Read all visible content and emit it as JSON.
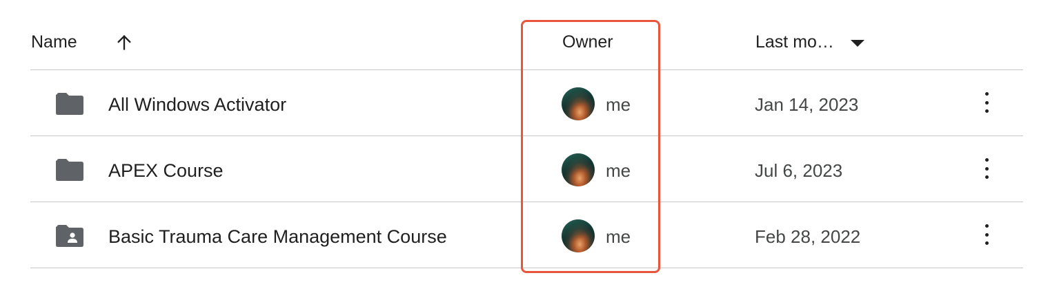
{
  "columns": {
    "name": "Name",
    "owner": "Owner",
    "last_modified": "Last mo…"
  },
  "icons": {
    "sort": "arrow-up-icon",
    "dropdown": "caret-down-icon",
    "folder": "folder-icon",
    "shared_folder": "shared-folder-icon",
    "more": "more-vert-icon"
  },
  "colors": {
    "highlight": "#e8553a",
    "folder": "#5f6368",
    "divider": "#c7c7c7"
  },
  "rows": [
    {
      "name": "All Windows Activator",
      "owner": "me",
      "modified": "Jan 14, 2023",
      "icon": "folder"
    },
    {
      "name": "APEX Course",
      "owner": "me",
      "modified": "Jul 6, 2023",
      "icon": "folder"
    },
    {
      "name": "Basic Trauma Care Management Course",
      "owner": "me",
      "modified": "Feb 28, 2022",
      "icon": "shared_folder"
    }
  ]
}
